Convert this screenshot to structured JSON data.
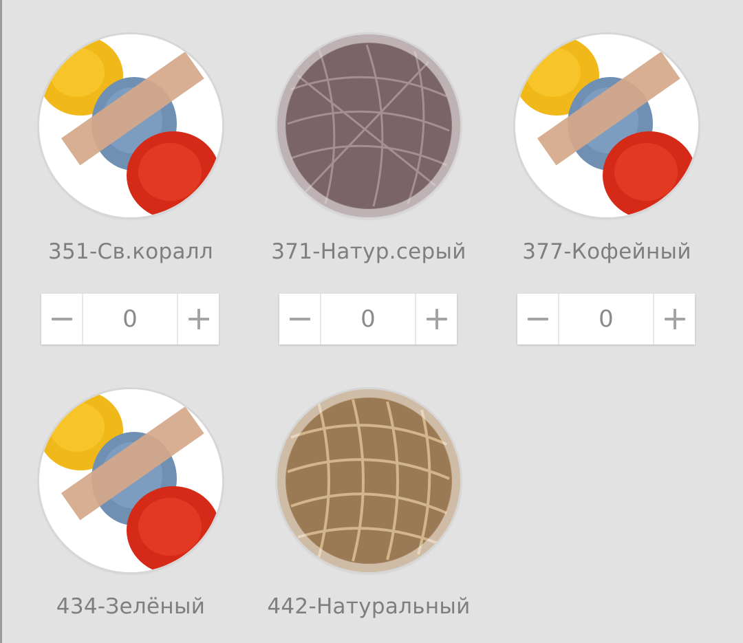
{
  "products": [
    {
      "code_name": "351-Св.коралл",
      "quantity": "0",
      "swatch": "multicolor-yarn-photo",
      "minus_symbol": "minus-icon",
      "plus_symbol": "plus-icon"
    },
    {
      "code_name": "371-Натур.серый",
      "quantity": "0",
      "swatch": "grey-yarn-ball-photo",
      "minus_symbol": "minus-icon",
      "plus_symbol": "plus-icon"
    },
    {
      "code_name": "377-Кофейный",
      "quantity": "0",
      "swatch": "multicolor-yarn-photo",
      "minus_symbol": "minus-icon",
      "plus_symbol": "plus-icon"
    },
    {
      "code_name": "434-Зелёный",
      "quantity": "",
      "swatch": "multicolor-yarn-photo"
    },
    {
      "code_name": "442-Натуральный",
      "quantity": "",
      "swatch": "natural-jute-ball-photo"
    }
  ],
  "colors": {
    "background": "#e2e2e2",
    "label_text": "#7e7e7e",
    "stepper_bg": "#ffffff",
    "stepper_icon": "#a3a3a3"
  }
}
